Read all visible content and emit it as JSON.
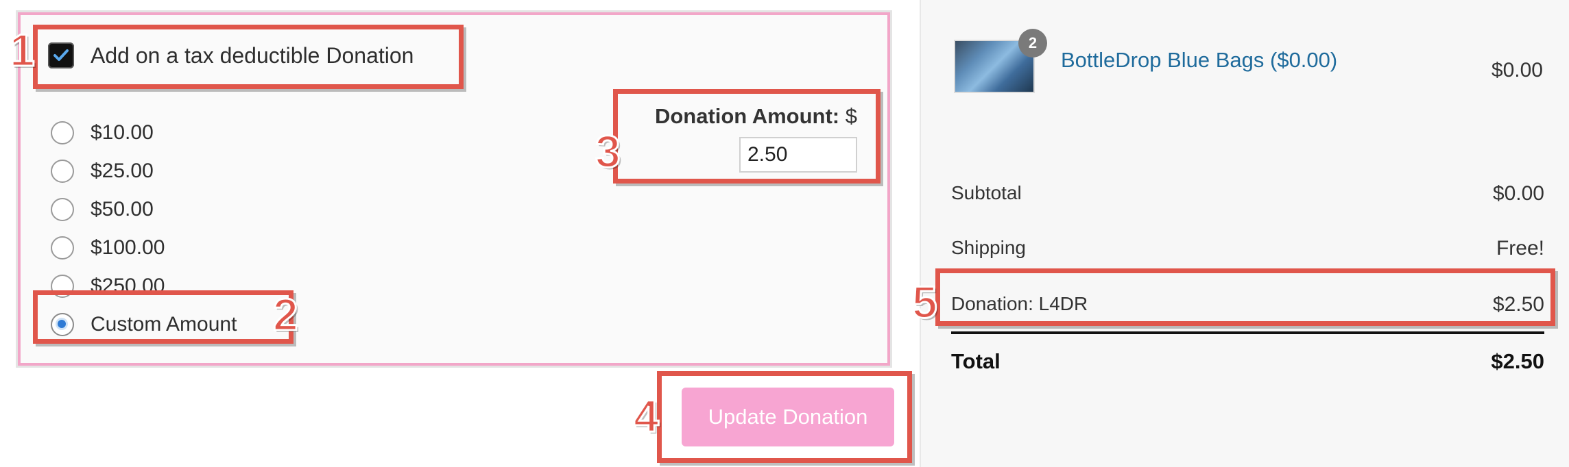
{
  "donation": {
    "checkbox_label": "Add on a tax deductible Donation",
    "checkbox_checked": true,
    "options": [
      {
        "label": "$10.00",
        "selected": false
      },
      {
        "label": "$25.00",
        "selected": false
      },
      {
        "label": "$50.00",
        "selected": false
      },
      {
        "label": "$100.00",
        "selected": false
      },
      {
        "label": "$250.00",
        "selected": false
      },
      {
        "label": "Custom Amount",
        "selected": true
      }
    ],
    "amount_label": "Donation Amount:",
    "amount_currency": "$",
    "amount_value": "2.50",
    "update_button": "Update Donation"
  },
  "summary": {
    "product": {
      "name": "BottleDrop Blue Bags ($0.00)",
      "quantity": "2",
      "price": "$0.00"
    },
    "subtotal_label": "Subtotal",
    "subtotal_value": "$0.00",
    "shipping_label": "Shipping",
    "shipping_value": "Free!",
    "donation_label": "Donation: L4DR",
    "donation_value": "$2.50",
    "total_label": "Total",
    "total_value": "$2.50"
  },
  "callouts": [
    "1",
    "2",
    "3",
    "4",
    "5"
  ],
  "colors": {
    "accent_pink": "#f7a5d2",
    "callout_red": "#e0564b",
    "link_blue": "#1f6b9c"
  }
}
